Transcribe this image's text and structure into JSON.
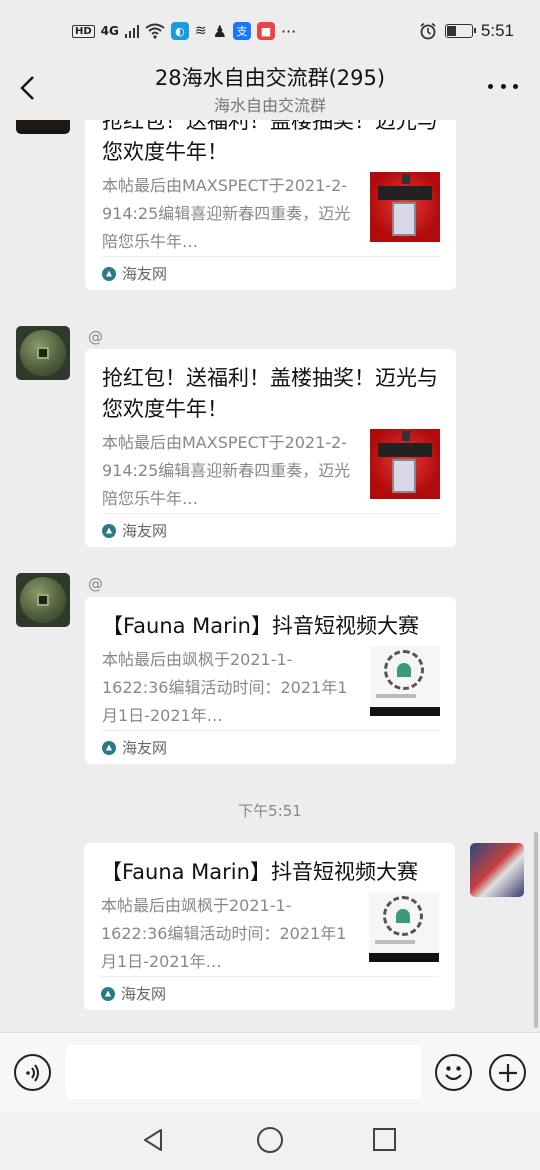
{
  "status_bar": {
    "hd": "HD",
    "signal": "4G",
    "time": "5:51",
    "icons": [
      "wifi-icon",
      "app-blue-icon",
      "wind-icon",
      "qq-icon",
      "alipay-icon",
      "app-red-icon",
      "more-dots-icon",
      "alarm-icon",
      "battery-icon"
    ]
  },
  "header": {
    "title": "28海水自由交流群(295)",
    "subtitle": "海水自由交流群"
  },
  "messages": [
    {
      "side": "left",
      "sender_mark": "",
      "title": "抢红包！送福利！盖楼抽奖！迈光与您欢度牛年！",
      "desc": "本帖最后由MAXSPECT于2021-2-914:25编辑喜迎新春四重奏，迈光陪您乐牛年…",
      "source": "海友网"
    },
    {
      "side": "left",
      "sender_mark": "@",
      "title": "抢红包！送福利！盖楼抽奖！迈光与您欢度牛年！",
      "desc": "本帖最后由MAXSPECT于2021-2-914:25编辑喜迎新春四重奏，迈光陪您乐牛年…",
      "source": "海友网"
    },
    {
      "side": "left",
      "sender_mark": "@",
      "title": "【Fauna Marin】抖音短视频大赛",
      "desc": "本帖最后由飒枫于2021-1-1622:36编辑活动时间：2021年1月1日-2021年…",
      "source": "海友网"
    },
    {
      "side": "right",
      "sender_mark": "",
      "title": "【Fauna Marin】抖音短视频大赛",
      "desc": "本帖最后由飒枫于2021-1-1622:36编辑活动时间：2021年1月1日-2021年…",
      "source": "海友网"
    }
  ],
  "timestamp": "下午5:51",
  "input": {
    "placeholder": ""
  },
  "colors": {
    "background": "#ededed",
    "card": "#ffffff",
    "muted": "#888888"
  }
}
